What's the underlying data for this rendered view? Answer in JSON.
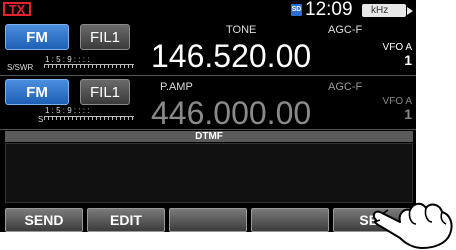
{
  "status": {
    "tx": "TX",
    "sd": "SD",
    "time": "12:09",
    "unit": "kHz"
  },
  "main": {
    "mode": "FM",
    "filter": "FIL1",
    "tone": "TONE",
    "agc": "AGC-F",
    "frequency": "146.520.00",
    "vfo": "VFO A",
    "vfo_num": "1",
    "meter_label": "S/SWR",
    "meter_scale": "1 : 5 : 9 : : : :"
  },
  "sub": {
    "mode": "FM",
    "filter": "FIL1",
    "pamp": "P.AMP",
    "agc": "AGC-F",
    "frequency": "446.000.00",
    "vfo": "VFO A",
    "vfo_num": "1",
    "meter_label": "S",
    "meter_scale": "1 : 5 : 9 : : : :"
  },
  "dtmf": {
    "title": "DTMF"
  },
  "softkeys": [
    "SEND",
    "EDIT",
    "",
    "",
    "SET"
  ]
}
